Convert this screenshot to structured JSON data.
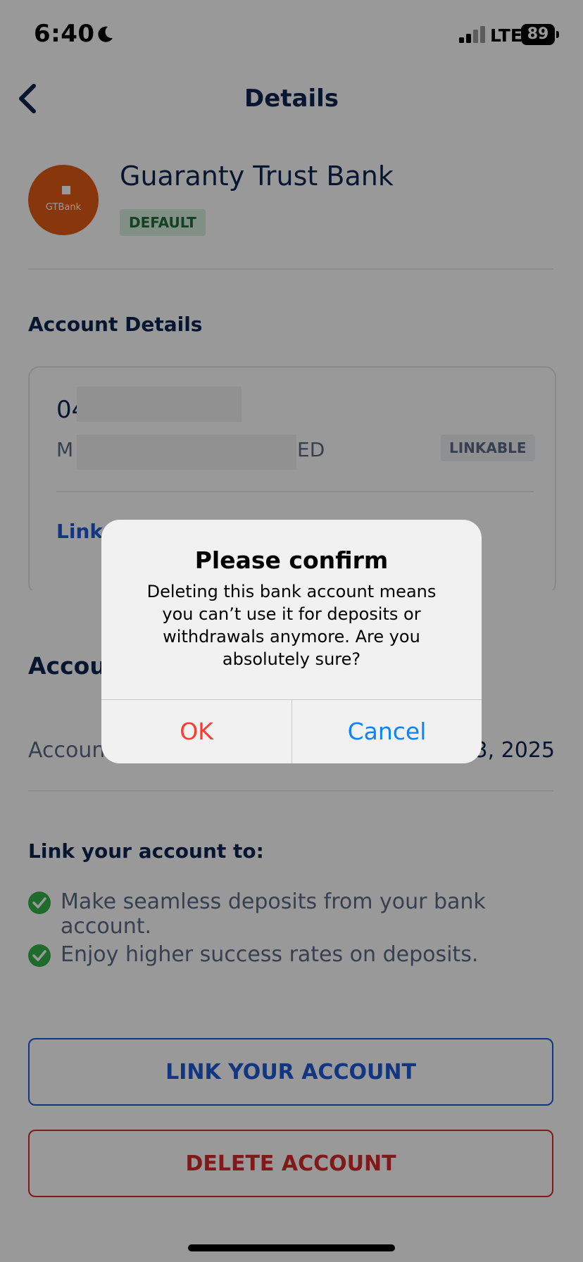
{
  "status_bar": {
    "time": "6:40",
    "network": "LTE",
    "battery": "89"
  },
  "header": {
    "title": "Details"
  },
  "bank": {
    "name": "Guaranty Trust Bank",
    "logo_text": "GTBank",
    "badge": "DEFAULT"
  },
  "account_details": {
    "title": "Account Details",
    "number_prefix": "04",
    "name_prefix": "M",
    "name_suffix": "ED",
    "status_badge": "LINKABLE",
    "link_label": "Link"
  },
  "sheet": {
    "title_partial": "Accou",
    "row_label_partial": "Accoun",
    "row_value_partial": "3, 2025",
    "link_title": "Link your account to:",
    "benefits": [
      "Make seamless deposits from your bank account.",
      "Enjoy higher success rates on deposits."
    ],
    "link_button": "LINK YOUR ACCOUNT",
    "delete_button": "DELETE ACCOUNT"
  },
  "alert": {
    "title": "Please confirm",
    "message": "Deleting this bank account means you can’t use it for deposits or withdrawals anymore. Are you absolutely sure?",
    "ok": "OK",
    "cancel": "Cancel"
  },
  "colors": {
    "primary_text": "#0b2350",
    "accent_blue": "#1f5bd6",
    "danger_red": "#d52a2a",
    "success_green": "#34b34a",
    "alert_ok": "#ff3b30",
    "alert_cancel": "#0a84ff",
    "logo_orange": "#e35a14"
  }
}
